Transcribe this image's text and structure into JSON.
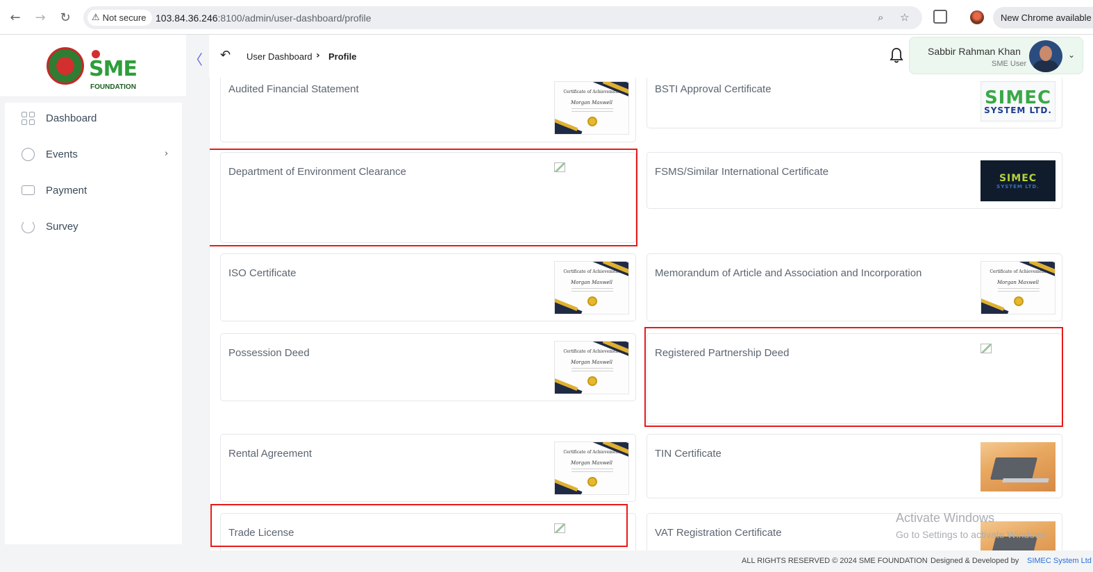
{
  "browser": {
    "security_label": "Not secure",
    "url_host": "103.84.36.246",
    "url_path": ":8100/admin/user-dashboard/profile",
    "update_label": "New Chrome available"
  },
  "brand": {
    "logo_text": "SME",
    "logo_subtext": "FOUNDATION"
  },
  "sidebar": {
    "items": [
      {
        "label": "Dashboard",
        "icon": "grid-icon"
      },
      {
        "label": "Events",
        "icon": "events-icon"
      },
      {
        "label": "Payment",
        "icon": "payment-card-icon"
      },
      {
        "label": "Survey",
        "icon": "survey-chart-icon"
      }
    ]
  },
  "header": {
    "breadcrumb_parent": "User Dashboard",
    "breadcrumb_current": "Profile",
    "user_name": "Sabbir Rahman Khan",
    "user_role": "SME User"
  },
  "documents": [
    {
      "title": "Audited Financial Statement",
      "thumb": "certificate"
    },
    {
      "title": "BSTI Approval Certificate",
      "thumb": "simec-logo"
    },
    {
      "title": "Department of Environment Clearance",
      "thumb": "broken-image",
      "highlighted": true
    },
    {
      "title": "FSMS/Similar International Certificate",
      "thumb": "simec-logo-dark"
    },
    {
      "title": "ISO Certificate",
      "thumb": "certificate"
    },
    {
      "title": "Memorandum of Article and Association and Incorporation",
      "thumb": "certificate"
    },
    {
      "title": "Possession Deed",
      "thumb": "certificate"
    },
    {
      "title": "Registered Partnership Deed",
      "thumb": "broken-image",
      "highlighted": true
    },
    {
      "title": "Rental Agreement",
      "thumb": "certificate"
    },
    {
      "title": "TIN Certificate",
      "thumb": "laptop-photo"
    },
    {
      "title": "Trade License",
      "thumb": "broken-image",
      "highlighted": true
    },
    {
      "title": "VAT Registration Certificate",
      "thumb": "laptop-photo"
    }
  ],
  "thumb_text": {
    "cert_title": "Certificate of Achievement",
    "cert_name": "Morgan Maxwell",
    "simec_word": "SIMEC",
    "simec_sub": "SYSTEM LTD."
  },
  "watermark": {
    "line1": "Activate Windows",
    "line2": "Go to Settings to activate Windows."
  },
  "footer": {
    "copyright": "ALL RIGHTS RESERVED © 2024 SME FOUNDATION",
    "designed_by": "Designed & Developed by",
    "developer": "SIMEC System Ltd"
  },
  "colors": {
    "highlight": "#e81919",
    "brand_green": "#2e9e3b",
    "accent_blue": "#2b6fd6"
  }
}
